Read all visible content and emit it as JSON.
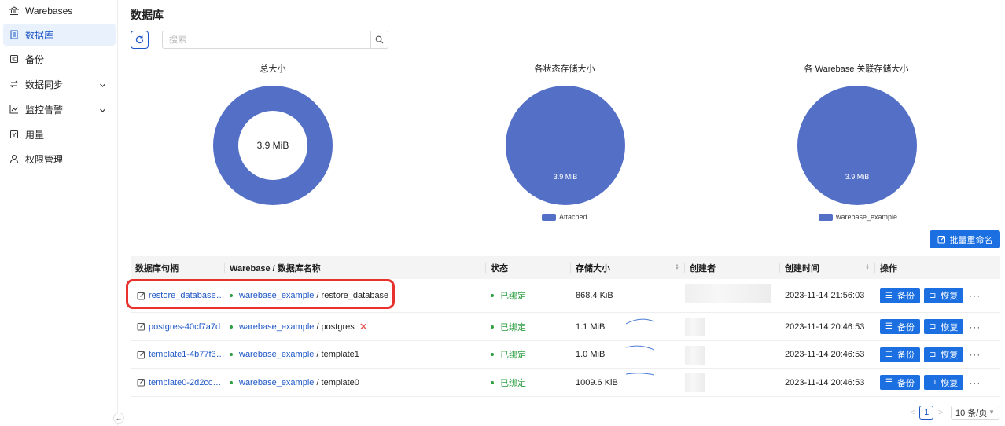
{
  "sidebar": {
    "items": [
      {
        "label": "Warebases",
        "icon": "bank-icon",
        "active": false,
        "expandable": false
      },
      {
        "label": "数据库",
        "icon": "database-icon",
        "active": true,
        "expandable": false
      },
      {
        "label": "备份",
        "icon": "backup-icon",
        "active": false,
        "expandable": false
      },
      {
        "label": "数据同步",
        "icon": "sync-icon",
        "active": false,
        "expandable": true
      },
      {
        "label": "监控告警",
        "icon": "line-chart-icon",
        "active": false,
        "expandable": true
      },
      {
        "label": "用量",
        "icon": "usage-icon",
        "active": false,
        "expandable": false
      },
      {
        "label": "权限管理",
        "icon": "user-icon",
        "active": false,
        "expandable": false
      }
    ],
    "collapse_glyph": "←"
  },
  "page": {
    "title": "数据库",
    "search_placeholder": "搜索",
    "rename_label": "批量重命名"
  },
  "colors": {
    "accent": "#1b6fe0",
    "chart": "#5470c6",
    "status_green": "#2ea043",
    "highlight": "#e8302d"
  },
  "chart_data": [
    {
      "type": "pie",
      "variant": "donut",
      "title": "总大小",
      "center_label": "3.9 MiB",
      "slices": [
        {
          "label": "",
          "value": 3.9
        }
      ],
      "legend": []
    },
    {
      "type": "pie",
      "title": "各状态存储大小",
      "slices": [
        {
          "label": "Attached",
          "value": 3.9,
          "data_label": "3.9 MiB"
        }
      ],
      "legend": [
        "Attached"
      ],
      "legend_position": "bottom"
    },
    {
      "type": "pie",
      "title": "各 Warebase 关联存储大小",
      "slices": [
        {
          "label": "warebase_example",
          "value": 3.9,
          "data_label": "3.9 MiB"
        }
      ],
      "legend": [
        "warebase_example"
      ],
      "legend_position": "bottom"
    }
  ],
  "table": {
    "columns": [
      "数据库句柄",
      "Warebase / 数据库名称",
      "状态",
      "存储大小",
      "创建者",
      "创建时间",
      "操作"
    ],
    "rows": [
      {
        "handle": "restore_database…",
        "warebase": "warebase_example",
        "name": " / restore_database",
        "status": "已绑定",
        "size": "868.4 KiB",
        "created": "2023-11-14 21:56:03",
        "has_x": false
      },
      {
        "handle": "postgres-40cf7a7d",
        "warebase": "warebase_example",
        "name": " / postgres",
        "status": "已绑定",
        "size": "1.1 MiB",
        "created": "2023-11-14 20:46:53",
        "has_x": true
      },
      {
        "handle": "template1-4b77f3…",
        "warebase": "warebase_example",
        "name": " / template1",
        "status": "已绑定",
        "size": "1.0 MiB",
        "created": "2023-11-14 20:46:53",
        "has_x": false
      },
      {
        "handle": "template0-2d2cc…",
        "warebase": "warebase_example",
        "name": " / template0",
        "status": "已绑定",
        "size": "1009.6 KiB",
        "created": "2023-11-14 20:46:53",
        "has_x": false
      }
    ],
    "actions": {
      "backup": "备份",
      "restore": "恢复",
      "more": "···"
    },
    "x_glyph": "✕"
  },
  "pagination": {
    "current": "1",
    "page_size": "10 条/页"
  }
}
